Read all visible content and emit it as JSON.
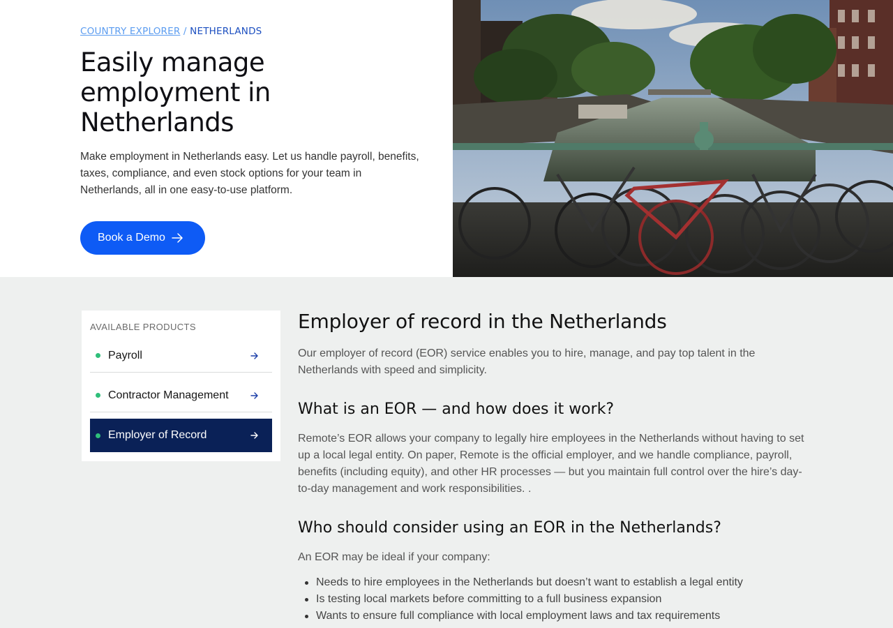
{
  "breadcrumb": {
    "link": "COUNTRY EXPLORER",
    "separator": "/",
    "current": "NETHERLANDS"
  },
  "hero": {
    "title": "Easily manage employment in Netherlands",
    "description": "Make employment in Netherlands easy. Let us handle payroll, benefits, taxes, compliance, and even stock options for your team in Netherlands, all in one easy-to-use platform.",
    "cta_label": "Book a Demo"
  },
  "products": {
    "heading": "AVAILABLE PRODUCTS",
    "items": [
      {
        "label": "Payroll",
        "active": false
      },
      {
        "label": "Contractor Management",
        "active": false
      },
      {
        "label": "Employer of Record",
        "active": true
      }
    ]
  },
  "content": {
    "title": "Employer of record in the Netherlands",
    "intro": "Our employer of record (EOR) service enables you to hire, manage, and pay top talent in the Netherlands with speed and simplicity.",
    "section1_title": "What is an EOR — and how does it work?",
    "section1_body": "Remote’s EOR allows your company to legally hire employees in the Netherlands without having to set up a local legal entity. On paper, Remote is the official employer, and we handle compliance, payroll, benefits (including equity), and other HR processes — but you maintain full control over the hire’s day-to-day management and work responsibilities. .",
    "section2_title": "Who should consider using an EOR in the Netherlands?",
    "section2_lead": "An EOR may be ideal if your company:",
    "bullets": [
      "Needs to hire employees in the Netherlands but doesn’t want to establish a legal entity",
      "Is testing local markets before committing to a full business expansion",
      "Wants to ensure full compliance with local employment laws and tax requirements"
    ]
  },
  "colors": {
    "accent_blue": "#0e5bf5",
    "active_navy": "#0a2157",
    "status_green": "#2fbf7a"
  }
}
